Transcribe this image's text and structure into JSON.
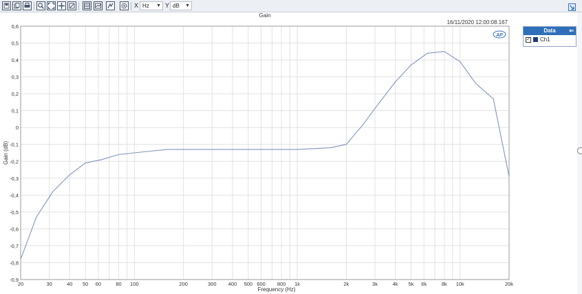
{
  "toolbar": {
    "x_axis_label": "X",
    "x_unit": "Hz",
    "y_axis_label": "Y",
    "y_unit": "dB",
    "icons": [
      "save-icon",
      "copy-icon",
      "print-icon",
      "zoom-icon",
      "zoom-fit-icon",
      "pan-icon",
      "autoscale-icon",
      "table-icon",
      "chart-settings-icon",
      "cursor-icon",
      "gear-icon"
    ]
  },
  "colors": {
    "series": "#7f93bd",
    "legend_header": "#2f6fb9",
    "swatch": "#1f3a80"
  },
  "timestamp": "16/11/2020 12:00:08.167",
  "logo_text": "AP",
  "legend": {
    "title": "Data",
    "items": [
      {
        "label": "Ch1",
        "checked": true
      }
    ]
  },
  "chart_data": {
    "type": "line",
    "title": "Gain",
    "xlabel": "Frequency (Hz)",
    "ylabel": "Gain (dB)",
    "xscale": "log",
    "xlim": [
      20,
      20000
    ],
    "ylim": [
      -0.9,
      0.6
    ],
    "grid": true,
    "legend_position": "right",
    "x_ticks": [
      {
        "v": 20,
        "label": "20"
      },
      {
        "v": 30,
        "label": "30"
      },
      {
        "v": 40,
        "label": "40"
      },
      {
        "v": 50,
        "label": "50"
      },
      {
        "v": 60,
        "label": "60"
      },
      {
        "v": 80,
        "label": "80"
      },
      {
        "v": 100,
        "label": "100"
      },
      {
        "v": 200,
        "label": "200"
      },
      {
        "v": 300,
        "label": "300"
      },
      {
        "v": 400,
        "label": "400"
      },
      {
        "v": 500,
        "label": "500"
      },
      {
        "v": 600,
        "label": "600"
      },
      {
        "v": 800,
        "label": "800"
      },
      {
        "v": 1000,
        "label": "1k"
      },
      {
        "v": 2000,
        "label": "2k"
      },
      {
        "v": 3000,
        "label": "3k"
      },
      {
        "v": 4000,
        "label": "4k"
      },
      {
        "v": 5000,
        "label": "5k"
      },
      {
        "v": 6000,
        "label": "6k"
      },
      {
        "v": 8000,
        "label": "8k"
      },
      {
        "v": 10000,
        "label": "10k"
      },
      {
        "v": 20000,
        "label": "20k"
      }
    ],
    "y_ticks": [
      {
        "v": 0.6,
        "label": "0,6"
      },
      {
        "v": 0.5,
        "label": "0,5"
      },
      {
        "v": 0.4,
        "label": "0,4"
      },
      {
        "v": 0.3,
        "label": "0,3"
      },
      {
        "v": 0.2,
        "label": "0,2"
      },
      {
        "v": 0.1,
        "label": "0,1"
      },
      {
        "v": 0,
        "label": "0"
      },
      {
        "v": -0.1,
        "label": "-0,1"
      },
      {
        "v": -0.2,
        "label": "-0,2"
      },
      {
        "v": -0.3,
        "label": "-0,3"
      },
      {
        "v": -0.4,
        "label": "-0,4"
      },
      {
        "v": -0.5,
        "label": "-0,5"
      },
      {
        "v": -0.6,
        "label": "-0,6"
      },
      {
        "v": -0.7,
        "label": "-0,7"
      },
      {
        "v": -0.8,
        "label": "-0,8"
      },
      {
        "v": -0.9,
        "label": "-0,9"
      }
    ],
    "series": [
      {
        "name": "Ch1",
        "x": [
          20,
          25,
          31.5,
          40,
          50,
          63,
          80,
          100,
          125,
          160,
          200,
          250,
          315,
          400,
          500,
          630,
          800,
          1000,
          1250,
          1600,
          2000,
          2500,
          3150,
          4000,
          5000,
          6300,
          8000,
          10000,
          12500,
          16000,
          20000
        ],
        "y": [
          -0.78,
          -0.53,
          -0.38,
          -0.28,
          -0.21,
          -0.19,
          -0.16,
          -0.15,
          -0.14,
          -0.13,
          -0.13,
          -0.13,
          -0.13,
          -0.13,
          -0.13,
          -0.13,
          -0.13,
          -0.13,
          -0.125,
          -0.12,
          -0.1,
          0.01,
          0.14,
          0.27,
          0.37,
          0.44,
          0.45,
          0.39,
          0.26,
          0.17,
          -0.29
        ]
      }
    ]
  }
}
